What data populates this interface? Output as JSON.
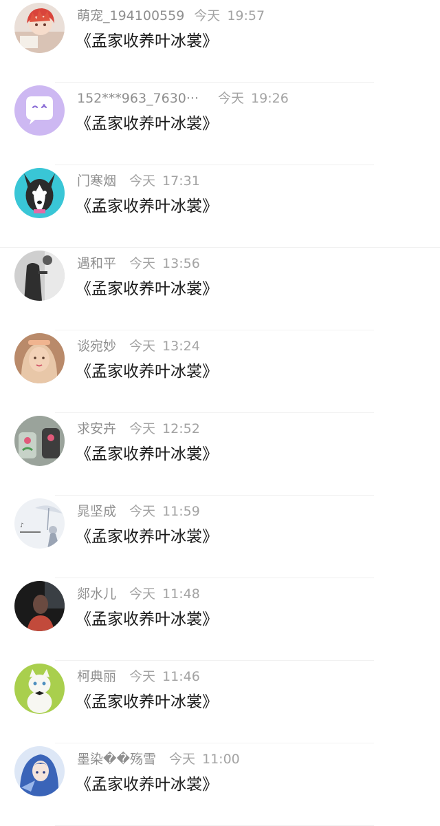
{
  "comments": [
    {
      "name": "萌宠_194100559",
      "day": "今天",
      "time": "19:57",
      "message": "《孟家收养叶冰裳》",
      "avatar_icon": "anime-boy-avatar",
      "avatar_colors": [
        "#f3d9d1",
        "#d9443b"
      ]
    },
    {
      "name": "152***963_7630···",
      "day": "今天",
      "time": "19:26",
      "message": "《孟家收养叶冰裳》",
      "avatar_icon": "chat-bubble-avatar",
      "avatar_colors": [
        "#cdb8f2",
        "#ffffff"
      ]
    },
    {
      "name": "门寒烟",
      "day": "今天",
      "time": "17:31",
      "message": "《孟家收养叶冰裳》",
      "avatar_icon": "husky-dog-avatar",
      "avatar_colors": [
        "#39c6d6",
        "#2b2b2b"
      ]
    },
    {
      "name": "遇和平",
      "day": "今天",
      "time": "13:56",
      "message": "《孟家收养叶冰裳》",
      "avatar_icon": "dark-figure-avatar",
      "avatar_colors": [
        "#d8d8d8",
        "#2e2e2e"
      ]
    },
    {
      "name": "谈宛妙",
      "day": "今天",
      "time": "13:24",
      "message": "《孟家收养叶冰裳》",
      "avatar_icon": "girl-portrait-avatar",
      "avatar_colors": [
        "#f0b48f",
        "#e8c7a8"
      ]
    },
    {
      "name": "求安卉",
      "day": "今天",
      "time": "12:52",
      "message": "《孟家收养叶冰裳》",
      "avatar_icon": "flower-pots-avatar",
      "avatar_colors": [
        "#9aa39b",
        "#e05a7a"
      ]
    },
    {
      "name": "晁坚成",
      "day": "今天",
      "time": "11:59",
      "message": "《孟家收养叶冰裳》",
      "avatar_icon": "umbrella-girl-avatar",
      "avatar_colors": [
        "#eef1f5",
        "#9aa4b4"
      ]
    },
    {
      "name": "郯水儿",
      "day": "今天",
      "time": "11:48",
      "message": "《孟家收养叶冰裳》",
      "avatar_icon": "dark-portrait-avatar",
      "avatar_colors": [
        "#1a1a1a",
        "#c24a3b"
      ]
    },
    {
      "name": "柯典丽",
      "day": "今天",
      "time": "11:46",
      "message": "《孟家收养叶冰裳》",
      "avatar_icon": "white-kitten-avatar",
      "avatar_colors": [
        "#a9cf4d",
        "#f7f7f2"
      ]
    },
    {
      "name": "墨染��殇雪",
      "day": "今天",
      "time": "11:00",
      "message": "《孟家收养叶冰裳》",
      "avatar_icon": "anime-blue-hair-avatar",
      "avatar_colors": [
        "#dde7f6",
        "#3a64b8"
      ]
    }
  ]
}
